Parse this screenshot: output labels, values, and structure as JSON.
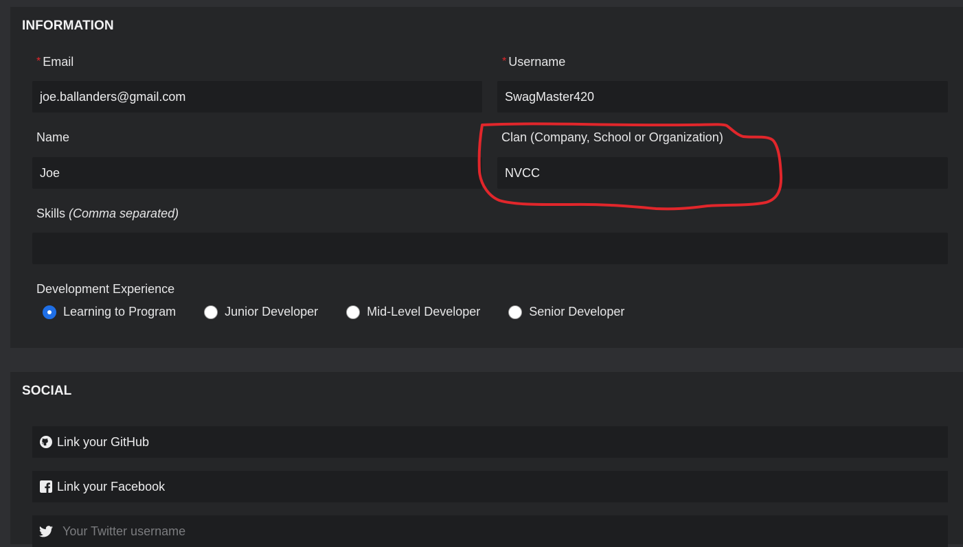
{
  "information": {
    "title": "INFORMATION",
    "required_marker": "*",
    "email": {
      "label": "Email",
      "value": "joe.ballanders@gmail.com"
    },
    "username": {
      "label": "Username",
      "value": "SwagMaster420"
    },
    "name": {
      "label": "Name",
      "value": "Joe"
    },
    "clan": {
      "label": "Clan (Company, School or Organization)",
      "value": "NVCC"
    },
    "skills": {
      "label": "Skills",
      "hint": "(Comma separated)",
      "value": ""
    },
    "experience": {
      "label": "Development Experience",
      "options": [
        {
          "label": "Learning to Program",
          "checked": true
        },
        {
          "label": "Junior Developer",
          "checked": false
        },
        {
          "label": "Mid-Level Developer",
          "checked": false
        },
        {
          "label": "Senior Developer",
          "checked": false
        }
      ]
    }
  },
  "social": {
    "title": "SOCIAL",
    "github": {
      "label": "Link your GitHub",
      "icon": "github-icon"
    },
    "facebook": {
      "label": "Link your Facebook",
      "icon": "facebook-icon"
    },
    "twitter": {
      "placeholder": "Your Twitter username",
      "icon": "twitter-icon"
    }
  },
  "colors": {
    "background": "#2e2f32",
    "panel": "#252628",
    "field": "#1d1e20",
    "required": "#e1262b",
    "radio_checked": "#1f6fe6",
    "annotation": "#e1262b"
  }
}
